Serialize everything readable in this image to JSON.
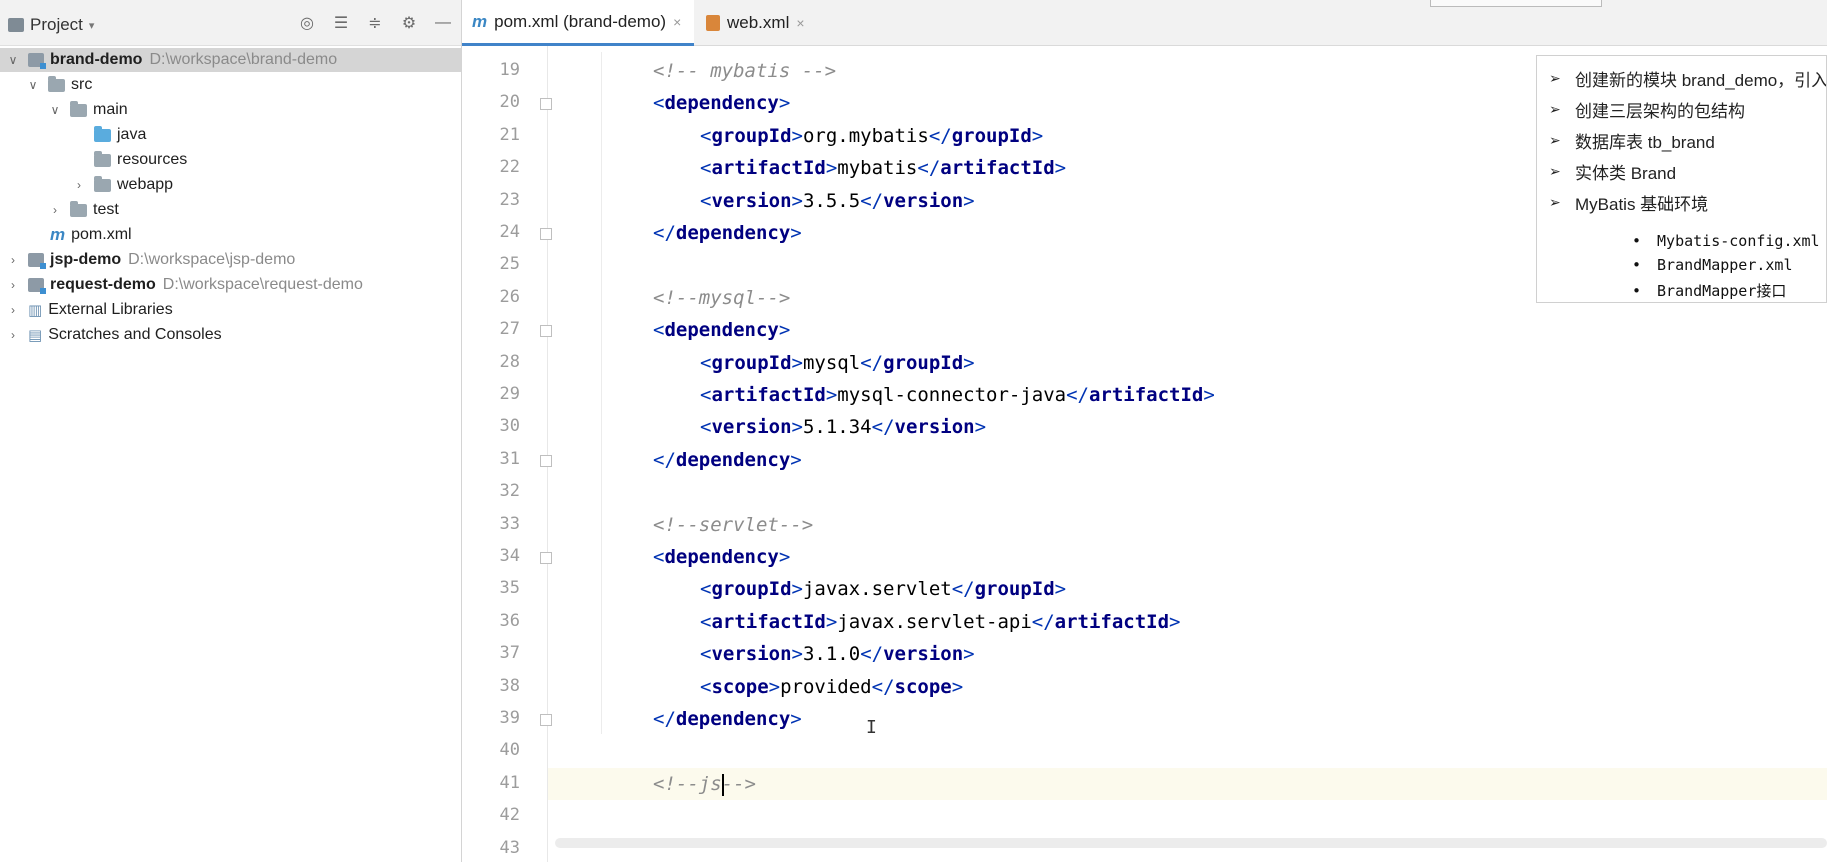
{
  "project": {
    "title": "Project",
    "tree": [
      {
        "label": "brand-demo",
        "path": "D:\\workspace\\brand-demo"
      },
      {
        "label": "src"
      },
      {
        "label": "main"
      },
      {
        "label": "java"
      },
      {
        "label": "resources"
      },
      {
        "label": "webapp"
      },
      {
        "label": "test"
      },
      {
        "label": "pom.xml"
      },
      {
        "label": "jsp-demo",
        "path": "D:\\workspace\\jsp-demo"
      },
      {
        "label": "request-demo",
        "path": "D:\\workspace\\request-demo"
      },
      {
        "label": "External Libraries"
      },
      {
        "label": "Scratches and Consoles"
      }
    ]
  },
  "tabs": [
    {
      "label": "pom.xml (brand-demo)",
      "close": "×"
    },
    {
      "label": "web.xml",
      "close": "×"
    }
  ],
  "editor": {
    "lines": [
      {
        "n": "19",
        "comment": "<!-- mybatis -->"
      },
      {
        "n": "20",
        "open": "dependency"
      },
      {
        "n": "21",
        "tag": "groupId",
        "value": "org.mybatis"
      },
      {
        "n": "22",
        "tag": "artifactId",
        "value": "mybatis"
      },
      {
        "n": "23",
        "tag": "version",
        "value": "3.5.5"
      },
      {
        "n": "24",
        "close": "dependency"
      },
      {
        "n": "25"
      },
      {
        "n": "26",
        "comment": "<!--mysql-->"
      },
      {
        "n": "27",
        "open": "dependency"
      },
      {
        "n": "28",
        "tag": "groupId",
        "value": "mysql"
      },
      {
        "n": "29",
        "tag": "artifactId",
        "value": "mysql-connector-java"
      },
      {
        "n": "30",
        "tag": "version",
        "value": "5.1.34"
      },
      {
        "n": "31",
        "close": "dependency"
      },
      {
        "n": "32"
      },
      {
        "n": "33",
        "comment": "<!--servlet-->"
      },
      {
        "n": "34",
        "open": "dependency"
      },
      {
        "n": "35",
        "tag": "groupId",
        "value": "javax.servlet"
      },
      {
        "n": "36",
        "tag": "artifactId",
        "value": "javax.servlet-api"
      },
      {
        "n": "37",
        "tag": "version",
        "value": "3.1.0"
      },
      {
        "n": "38",
        "tag": "scope",
        "value": "provided"
      },
      {
        "n": "39",
        "close": "dependency"
      },
      {
        "n": "40"
      },
      {
        "n": "41",
        "comment": "<!--js-->"
      },
      {
        "n": "42"
      },
      {
        "n": "43"
      }
    ],
    "mouse_cursor": "I"
  },
  "outline": {
    "items": [
      "创建新的模块 brand_demo，引入",
      "创建三层架构的包结构",
      "数据库表 tb_brand",
      "实体类 Brand",
      "MyBatis 基础环境"
    ],
    "sub_items": [
      "Mybatis-config.xml",
      "BrandMapper.xml",
      "BrandMapper接口"
    ]
  },
  "colors": {
    "tag_bracket": "#0033b3",
    "tag_name": "#000080",
    "comment": "#8c8c8c",
    "current_line": "#fcfaed",
    "selection": "#d5d5d5"
  }
}
